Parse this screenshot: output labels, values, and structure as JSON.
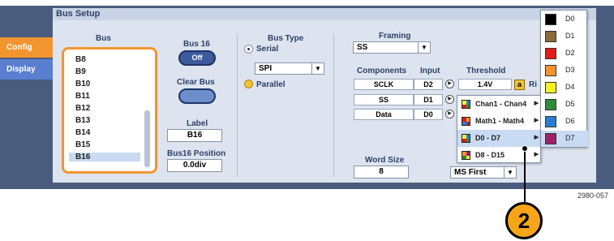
{
  "window": {
    "title": "Bus Setup"
  },
  "side_tabs": [
    {
      "label": "Config",
      "color": "#f3952f"
    },
    {
      "label": "Display",
      "color": "#5a7fd0"
    }
  ],
  "bus_section": {
    "heading": "Bus",
    "items": [
      "B8",
      "B9",
      "B10",
      "B11",
      "B12",
      "B13",
      "B14",
      "B15",
      "B16"
    ],
    "selected": "B16"
  },
  "bus16": {
    "heading": "Bus 16",
    "toggle_label": "Off",
    "clear_label": "Clear Bus",
    "label_heading": "Label",
    "label_value": "B16",
    "position_heading": "Bus16 Position",
    "position_value": "0.0div"
  },
  "bus_type": {
    "heading": "Bus Type",
    "options": [
      "Serial",
      "Parallel"
    ],
    "selected": "Serial",
    "protocol_value": "SPI"
  },
  "framing": {
    "heading": "Framing",
    "value": "SS"
  },
  "components_table": {
    "headers": [
      "Components",
      "Input",
      "Threshold"
    ],
    "rows": [
      {
        "component": "SCLK",
        "input": "D2",
        "threshold": "1.4V",
        "extra": "Ri"
      },
      {
        "component": "SS",
        "input": "D1"
      },
      {
        "component": "Data",
        "input": "D0"
      }
    ]
  },
  "source_menu": {
    "items": [
      {
        "label": "Chan1 - Chan4",
        "icon": "grid-icon-multicolor"
      },
      {
        "label": "Math1 - Math4",
        "icon": "grid-icon-multicolor"
      },
      {
        "label": "D0 - D7",
        "icon": "grid-icon-multicolor"
      },
      {
        "label": "D8 - D15",
        "icon": "grid-icon-multicolor"
      }
    ],
    "selected": "D0 - D7"
  },
  "digital_menu": {
    "items": [
      {
        "label": "D0",
        "color": "#000000"
      },
      {
        "label": "D1",
        "color": "#8b6a3e"
      },
      {
        "label": "D2",
        "color": "#e01b1b"
      },
      {
        "label": "D3",
        "color": "#f3952f"
      },
      {
        "label": "D4",
        "color": "#f5f02a"
      },
      {
        "label": "D5",
        "color": "#2f8a3a"
      },
      {
        "label": "D6",
        "color": "#2a7fd0"
      },
      {
        "label": "D7",
        "color": "#a0236a"
      }
    ],
    "selected": "D7"
  },
  "word_size": {
    "heading": "Word Size",
    "value": "8"
  },
  "bit_order": {
    "value": "MS First"
  },
  "callout": {
    "number": "2"
  },
  "figure_id": "2980-057"
}
